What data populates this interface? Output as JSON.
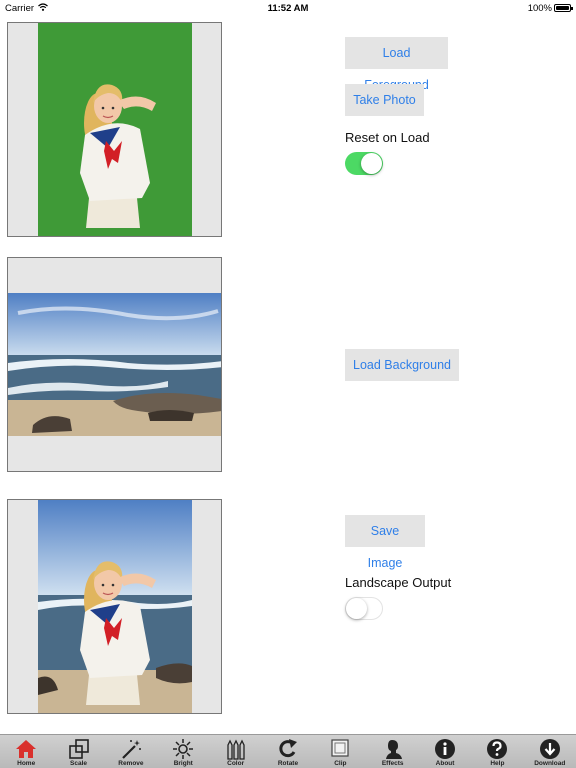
{
  "status_bar": {
    "carrier": "Carrier",
    "time": "11:52 AM",
    "battery": "100%"
  },
  "foreground": {
    "load_label": "Load Foreground",
    "photo_label": "Take Photo",
    "reset_label": "Reset on Load",
    "reset_on": true
  },
  "background": {
    "load_label": "Load Background"
  },
  "output": {
    "save_label": "Save Image",
    "landscape_label": "Landscape Output",
    "landscape_on": false
  },
  "tabs": [
    {
      "label": "Home",
      "icon": "home-icon",
      "active": true
    },
    {
      "label": "Scale",
      "icon": "scale-icon"
    },
    {
      "label": "Remove",
      "icon": "magic-wand-icon"
    },
    {
      "label": "Bright",
      "icon": "sun-icon"
    },
    {
      "label": "Color",
      "icon": "crayons-icon"
    },
    {
      "label": "Rotate",
      "icon": "rotate-icon"
    },
    {
      "label": "Clip",
      "icon": "clip-icon"
    },
    {
      "label": "Effects",
      "icon": "silhouette-icon"
    },
    {
      "label": "About",
      "icon": "info-icon"
    },
    {
      "label": "Help",
      "icon": "help-icon"
    },
    {
      "label": "Download",
      "icon": "download-icon"
    }
  ],
  "colors": {
    "accent": "#2f7fe8",
    "switch_on": "#4cd964",
    "home_active": "#d9302c",
    "green_screen": "#3f9a37"
  }
}
